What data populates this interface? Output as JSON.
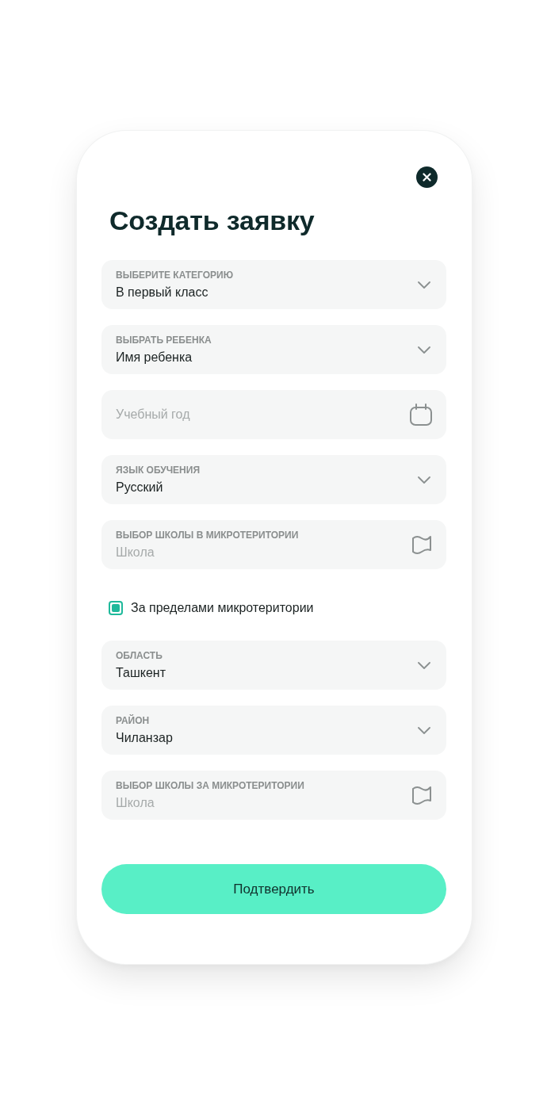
{
  "title": "Создать заявку",
  "form": {
    "items": [
      {
        "kind": "select",
        "label": "ВЫБЕРИТЕ КАТЕГОРИЮ",
        "value": "В первый класс"
      },
      {
        "kind": "select",
        "label": "ВЫБРАТЬ РЕБЕНКА",
        "value": "Имя ребенка"
      },
      {
        "kind": "date",
        "placeholder": "Учебный год"
      },
      {
        "kind": "select",
        "label": "ЯЗЫК ОБУЧЕНИЯ",
        "value": "Русский"
      },
      {
        "kind": "map",
        "label": "ВЫБОР ШКОЛЫ В МИКРОТЕРИТОРИИ",
        "placeholder": "Школа"
      },
      {
        "kind": "checkbox",
        "label": "За пределами микротеритории",
        "checked": true
      },
      {
        "kind": "select",
        "label": "ОБЛАСТЬ",
        "value": "Ташкент"
      },
      {
        "kind": "select",
        "label": "РАЙОН",
        "value": "Чиланзар"
      },
      {
        "kind": "map",
        "label": "ВЫБОР ШКОЛЫ ЗА МИКРОТЕРИТОРИИ",
        "placeholder": "Школа"
      }
    ]
  },
  "submit_button": {
    "label": "Подтвердить"
  }
}
